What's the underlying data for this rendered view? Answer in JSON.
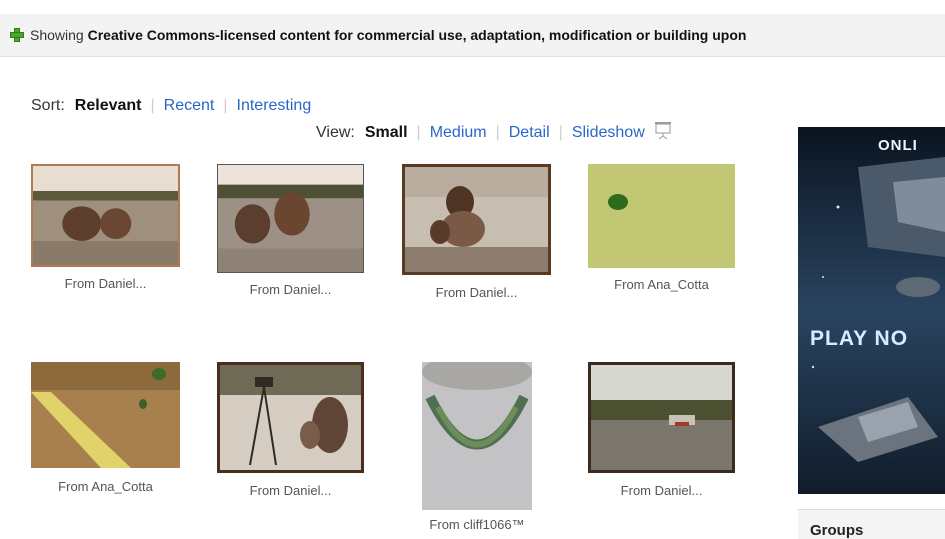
{
  "notice": {
    "prefix": "Showing",
    "bold_text": "Creative Commons-licensed content for commercial use, adaptation, modification or building upon",
    "icon": "plus-icon"
  },
  "sort": {
    "label": "Sort:",
    "options": [
      "Relevant",
      "Recent",
      "Interesting"
    ],
    "selected": "Relevant"
  },
  "view": {
    "label": "View:",
    "options": [
      "Small",
      "Medium",
      "Detail",
      "Slideshow"
    ],
    "selected": "Small",
    "slideshow_icon": "projector-icon"
  },
  "photos": [
    {
      "caption": "From Daniel..."
    },
    {
      "caption": "From Daniel..."
    },
    {
      "caption": "From Daniel..."
    },
    {
      "caption": "From Ana_Cotta"
    },
    {
      "caption": "From Ana_Cotta"
    },
    {
      "caption": "From Daniel..."
    },
    {
      "caption": "From cliff1066™"
    },
    {
      "caption": "From Daniel..."
    }
  ],
  "ad": {
    "top_text": "ONLI",
    "play_text": "PLAY NO"
  },
  "sidebar": {
    "groups_heading": "Groups"
  }
}
